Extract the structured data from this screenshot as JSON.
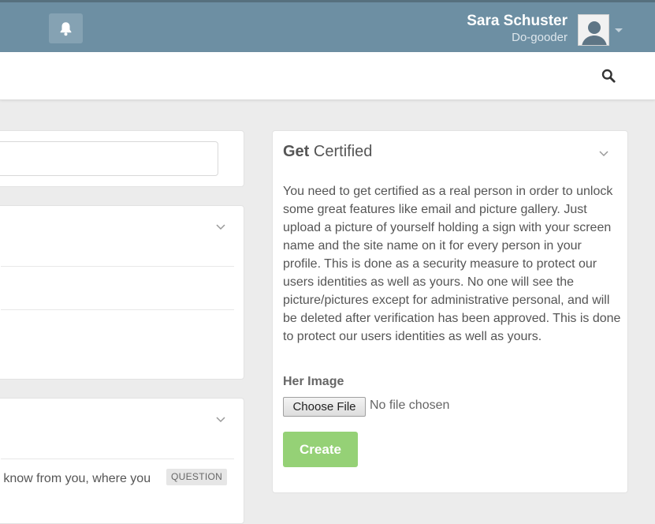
{
  "header": {
    "user_name": "Sara Schuster",
    "user_role": "Do-gooder"
  },
  "left": {
    "question_text_partial": "o know from you, where you",
    "question_badge": "QUESTION"
  },
  "certified": {
    "title_bold": "Get",
    "title_rest": "Certified",
    "description": "You need to get certified as a real person in order to unlock some great features like email and picture gallery. Just upload a picture of yourself holding a sign with your screen name and the site name on it for every person in your profile. This is done as a security measure to protect our users identities as well as yours. No one will see the picture/pictures except for administrative personal, and will be deleted after verification has been approved. This is done to protect our users identities as well as yours.",
    "image_label": "Her Image",
    "choose_file_label": "Choose File",
    "file_status": "No file chosen",
    "create_label": "Create"
  },
  "colors": {
    "topbar": "#6d8fa3",
    "create_button": "#95d176"
  },
  "icons": [
    "bell-icon",
    "avatar-icon",
    "caret-down-icon",
    "search-icon",
    "chevron-down-icon"
  ]
}
